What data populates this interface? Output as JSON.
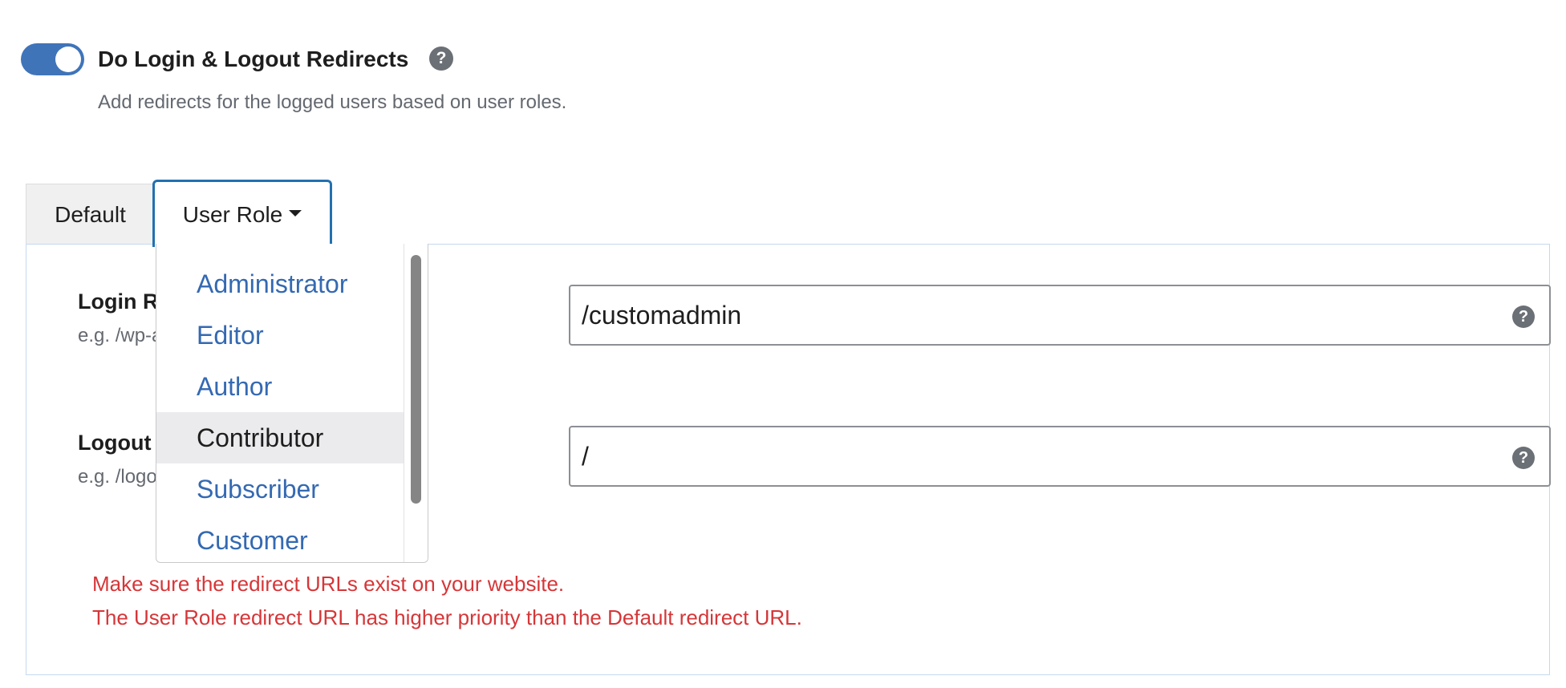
{
  "setting": {
    "title": "Do Login & Logout Redirects",
    "description": "Add redirects for the logged users based on user roles.",
    "enabled": true,
    "help_glyph": "?"
  },
  "tabs": {
    "default_label": "Default",
    "user_role_label": "User Role"
  },
  "fields": {
    "login": {
      "label": "Login Redirect",
      "hint": "e.g. /wp-admin",
      "value": "/customadmin"
    },
    "logout": {
      "label": "Logout Redirect",
      "hint": "e.g. /logout",
      "value": "/"
    }
  },
  "dropdown": {
    "items": [
      "Administrator",
      "Editor",
      "Author",
      "Contributor",
      "Subscriber",
      "Customer"
    ],
    "hovered": "Contributor"
  },
  "notices": {
    "line1": "Make sure the redirect URLs exist on your website.",
    "line2": "The User Role redirect URL has higher priority than the Default redirect URL."
  },
  "colors": {
    "toggle_on": "#3f74b9",
    "tab_active_border": "#2271b1",
    "link": "#3469b2",
    "notice": "#d63638"
  },
  "icons": {
    "help": "question-circle-icon",
    "caret": "caret-down-icon"
  }
}
